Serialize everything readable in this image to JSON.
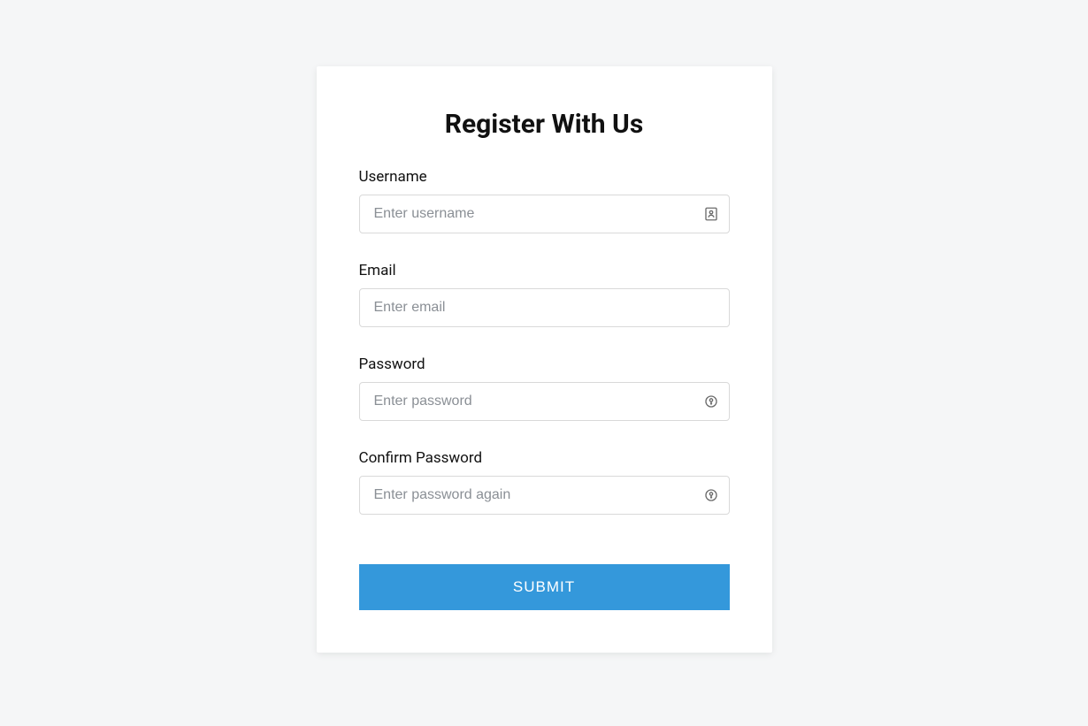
{
  "form": {
    "title": "Register With Us",
    "fields": {
      "username": {
        "label": "Username",
        "placeholder": "Enter username",
        "value": ""
      },
      "email": {
        "label": "Email",
        "placeholder": "Enter email",
        "value": ""
      },
      "password": {
        "label": "Password",
        "placeholder": "Enter password",
        "value": ""
      },
      "confirmPassword": {
        "label": "Confirm Password",
        "placeholder": "Enter password again",
        "value": ""
      }
    },
    "submit_label": "SUBMIT"
  },
  "colors": {
    "primary": "#3498db",
    "background": "#f5f6f7",
    "card": "#ffffff",
    "border": "#d9d9d9",
    "placeholder": "#8a8f95"
  }
}
